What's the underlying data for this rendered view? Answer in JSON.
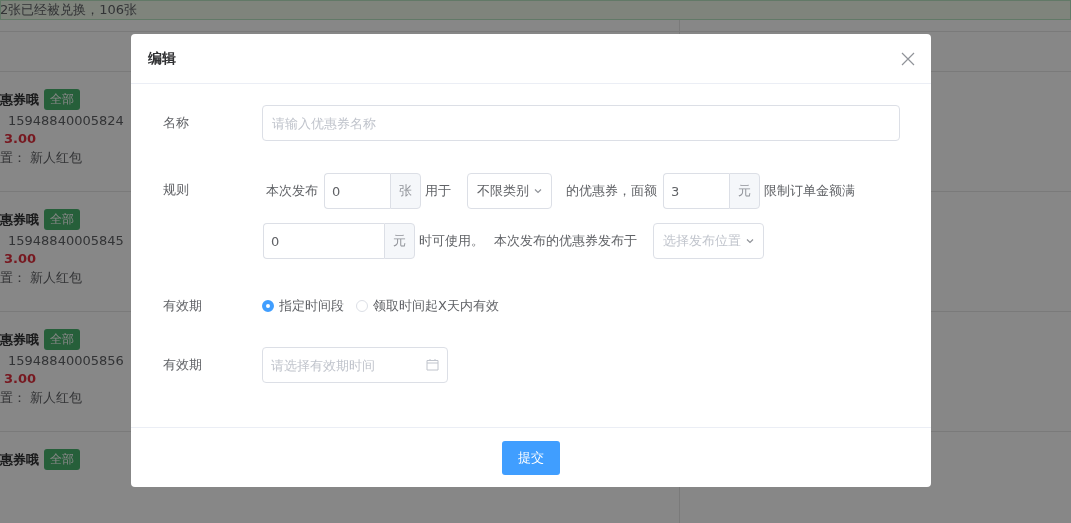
{
  "background": {
    "notice": "2张已经被兑换，106张",
    "coupons": [
      {
        "name": "惠券哦",
        "tag": "全部",
        "phone": "15948840005824",
        "price": "3.00",
        "placement": "置：  新人红包"
      },
      {
        "name": "惠券哦",
        "tag": "全部",
        "phone": "15948840005845",
        "price": "3.00",
        "placement": "置：  新人红包"
      },
      {
        "name": "惠券哦",
        "tag": "全部",
        "phone": "15948840005856",
        "price": "3.00",
        "placement": "置：  新人红包"
      },
      {
        "name": "惠券哦",
        "tag": "全部"
      }
    ]
  },
  "dialog": {
    "title": "编辑",
    "name_field": {
      "label": "名称",
      "placeholder": "请输入优惠券名称"
    },
    "rules": {
      "label": "规则",
      "items": [
        {
          "kind": "text",
          "text": "本次发布"
        },
        {
          "kind": "input",
          "value": "0",
          "unit": "张"
        },
        {
          "kind": "text",
          "text": "用于"
        },
        {
          "kind": "select",
          "value": "不限类别"
        },
        {
          "kind": "text",
          "text": "的优惠券，面额"
        },
        {
          "kind": "input",
          "value": "3",
          "unit": "元"
        },
        {
          "kind": "text",
          "text": "限制订单金额满"
        },
        {
          "kind": "input",
          "value": "0",
          "unit": "元",
          "wide": true
        },
        {
          "kind": "text",
          "text": "时可使用。"
        },
        {
          "kind": "text",
          "text": "本次发布的优惠券发布于"
        },
        {
          "kind": "select",
          "placeholder": "选择发布位置"
        }
      ]
    },
    "validity": {
      "label": "有效期",
      "options": [
        {
          "label": "指定时间段",
          "selected": true
        },
        {
          "label": "领取时间起X天内有效",
          "selected": false
        }
      ]
    },
    "date_field": {
      "label": "有效期",
      "placeholder": "请选择有效期时间"
    },
    "submit": "提交"
  }
}
